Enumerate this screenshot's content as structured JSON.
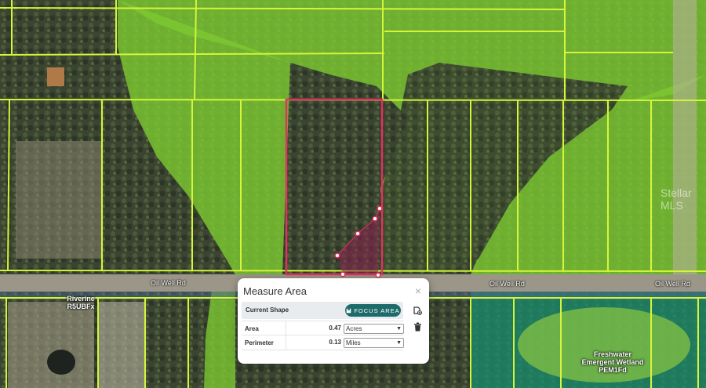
{
  "map": {
    "road_labels": [
      "Oil Well Rd",
      "Oil Well Rd",
      "Oil Well Rd"
    ],
    "wetland_labels": [
      {
        "lines": [
          "Riverine",
          "R5UBFx"
        ]
      },
      {
        "lines": [
          "Freshwater",
          "Emergent Wetland",
          "PEM1Fd"
        ]
      }
    ],
    "watermark": "Stellar MLS",
    "colors": {
      "parcel_lines": "#d4f53a",
      "measured_shape": "#e0335f",
      "wetland_green": "#7cc832",
      "wetland_teal": "#1a8a6a"
    }
  },
  "measure_panel": {
    "title": "Measure Area",
    "close_icon": "×",
    "current_shape_label": "Current Shape",
    "focus_area_label": "FOCUS AREA",
    "rows": [
      {
        "label": "Area",
        "value": "0.47",
        "unit": "Acres"
      },
      {
        "label": "Perimeter",
        "value": "0.13",
        "unit": "Miles"
      }
    ],
    "side_icons": [
      "add-shape-icon",
      "trash-icon"
    ]
  }
}
